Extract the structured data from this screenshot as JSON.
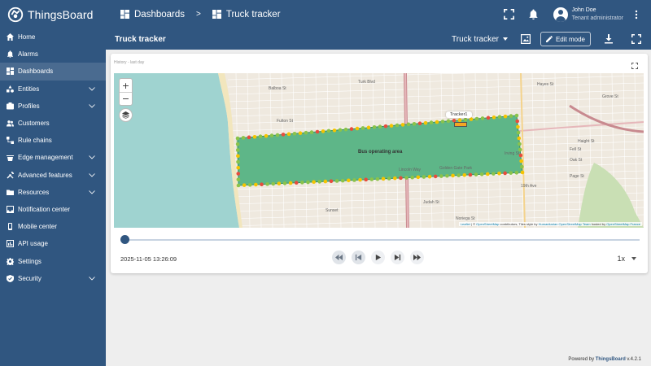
{
  "app": {
    "name": "ThingsBoard"
  },
  "breadcrumbs": {
    "dashboards": "Dashboards",
    "separator": ">",
    "current": "Truck tracker"
  },
  "user": {
    "name": "John Doe",
    "role": "Tenant administrator"
  },
  "sidebar": {
    "items": [
      {
        "label": "Home",
        "icon": "home-icon"
      },
      {
        "label": "Alarms",
        "icon": "bell-icon"
      },
      {
        "label": "Dashboards",
        "icon": "dashboard-icon",
        "active": true
      },
      {
        "label": "Entities",
        "icon": "entities-icon",
        "expandable": true
      },
      {
        "label": "Profiles",
        "icon": "profiles-icon",
        "expandable": true
      },
      {
        "label": "Customers",
        "icon": "customers-icon"
      },
      {
        "label": "Rule chains",
        "icon": "rule-chains-icon"
      },
      {
        "label": "Edge management",
        "icon": "edge-icon",
        "expandable": true
      },
      {
        "label": "Advanced features",
        "icon": "tools-icon",
        "expandable": true
      },
      {
        "label": "Resources",
        "icon": "folder-icon",
        "expandable": true
      },
      {
        "label": "Notification center",
        "icon": "inbox-icon"
      },
      {
        "label": "Mobile center",
        "icon": "mobile-icon"
      },
      {
        "label": "API usage",
        "icon": "chart-icon"
      },
      {
        "label": "Settings",
        "icon": "gear-icon"
      },
      {
        "label": "Security",
        "icon": "shield-icon",
        "expandable": true
      }
    ]
  },
  "dashboard": {
    "title": "Truck tracker",
    "state": "Truck tracker",
    "edit_label": "Edit mode"
  },
  "widget": {
    "title": "History - last day",
    "area_label": "Bus operating area",
    "tracker_label": "Tracker1",
    "zoom_in": "+",
    "zoom_out": "−",
    "street_labels": [
      "Balboa St",
      "Fulton St",
      "Lincoln Way",
      "Judah St",
      "Noriega St",
      "Irving St",
      "Haight St",
      "Fell St",
      "Oak St",
      "Page St",
      "Turk Blvd",
      "Hayes St",
      "Golden Gate Park",
      "Sunset",
      "19th Ave",
      "Grove St"
    ],
    "attribution": {
      "leaflet": "Leaflet",
      "sep": " | © ",
      "osm": "OpenStreetMap",
      "rest1": " contributors, Tiles style by ",
      "hot": "Humanitarian OpenStreetMap Team",
      "rest2": " hosted by ",
      "fr": "OpenStreetMap France"
    },
    "timestamp": "2025-11-05 13:26:09",
    "speed": "1x",
    "progress": 0
  },
  "footer": {
    "prefix": "Powered by ",
    "brand": "ThingsBoard",
    "version": " v.4.2.1"
  },
  "colors": {
    "primary": "#305680",
    "water": "#9fd3d0",
    "area": "#3aa87a",
    "dot_green": "#8bc34a",
    "dot_yellow": "#f5c400",
    "dot_red": "#e74c3c"
  }
}
